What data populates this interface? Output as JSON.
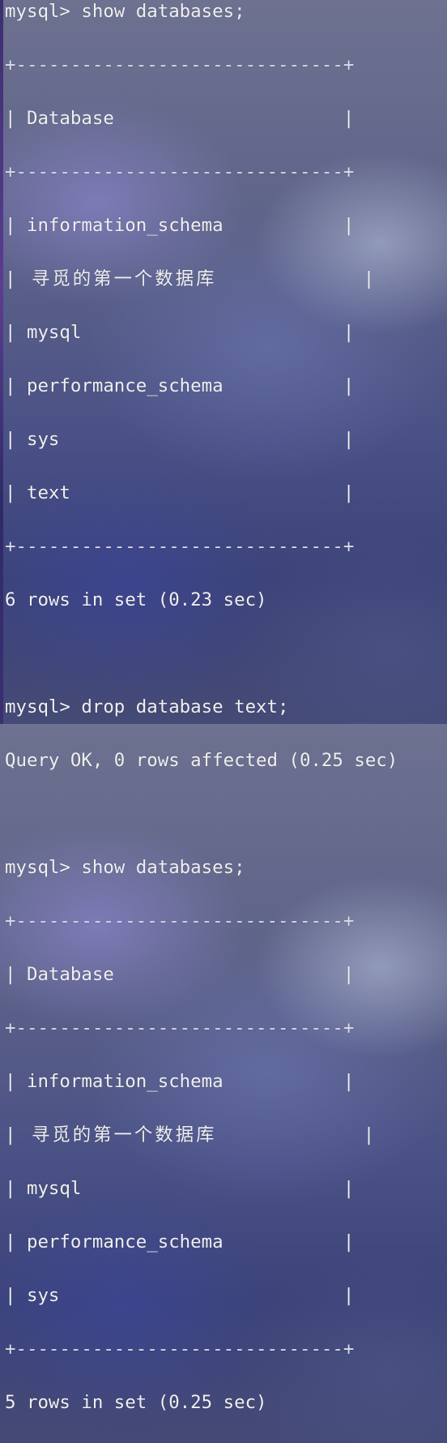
{
  "terminal": {
    "lines": [
      {
        "text": "mysql> show databases;",
        "kind": "command"
      },
      {
        "text": "+------------------------------+",
        "kind": "border"
      },
      {
        "text": "| Database                     |",
        "kind": "header"
      },
      {
        "text": "+------------------------------+",
        "kind": "border"
      },
      {
        "text": "| information_schema           |",
        "kind": "row"
      },
      {
        "text": "| 寻觅的第一个数据库           |",
        "kind": "row-cjk"
      },
      {
        "text": "| mysql                        |",
        "kind": "row"
      },
      {
        "text": "| performance_schema           |",
        "kind": "row"
      },
      {
        "text": "| sys                          |",
        "kind": "row"
      },
      {
        "text": "| text                         |",
        "kind": "row"
      },
      {
        "text": "+------------------------------+",
        "kind": "border"
      },
      {
        "text": "6 rows in set (0.23 sec)",
        "kind": "result"
      },
      {
        "text": "",
        "kind": "blank"
      },
      {
        "text": "mysql> drop database text;",
        "kind": "command"
      },
      {
        "text": "Query OK, 0 rows affected (0.25 sec)",
        "kind": "result"
      },
      {
        "text": "",
        "kind": "blank"
      },
      {
        "text": "mysql> show databases;",
        "kind": "command"
      },
      {
        "text": "+------------------------------+",
        "kind": "border"
      },
      {
        "text": "| Database                     |",
        "kind": "header"
      },
      {
        "text": "+------------------------------+",
        "kind": "border"
      },
      {
        "text": "| information_schema           |",
        "kind": "row"
      },
      {
        "text": "| 寻觅的第一个数据库           |",
        "kind": "row-cjk"
      },
      {
        "text": "| mysql                        |",
        "kind": "row"
      },
      {
        "text": "| performance_schema           |",
        "kind": "row"
      },
      {
        "text": "| sys                          |",
        "kind": "row"
      },
      {
        "text": "+------------------------------+",
        "kind": "border"
      },
      {
        "text": "5 rows in set (0.25 sec)",
        "kind": "result"
      }
    ]
  }
}
